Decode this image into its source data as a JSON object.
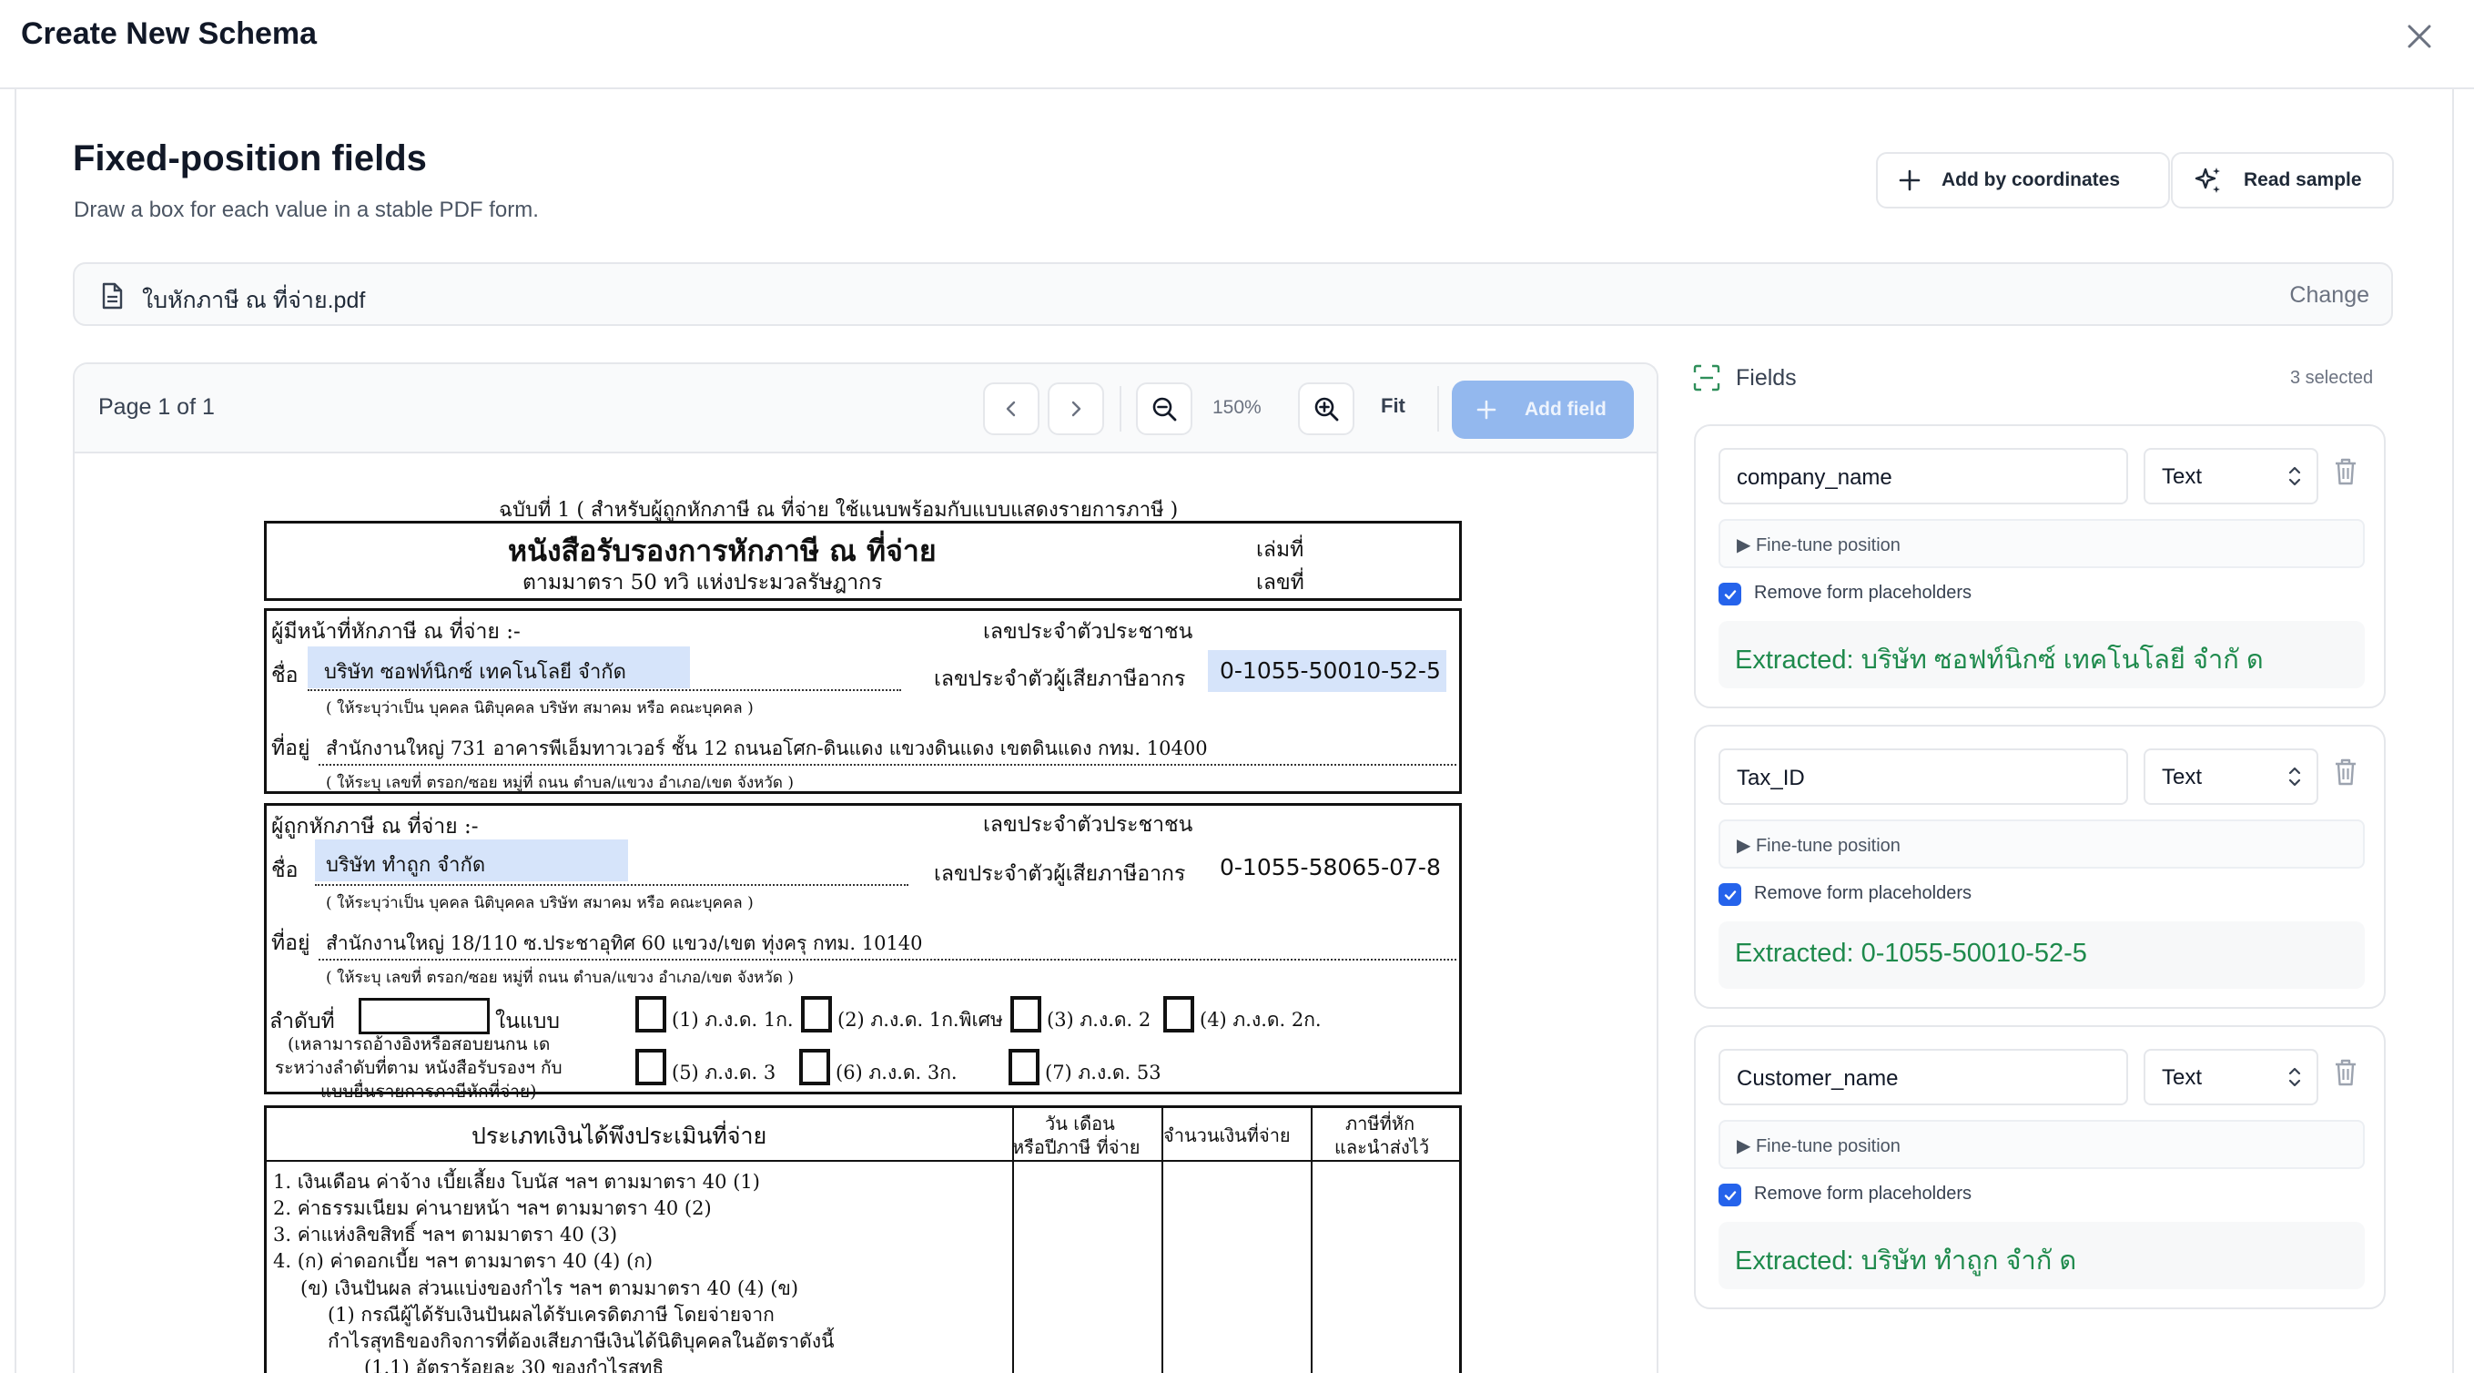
{
  "header": {
    "title": "Create New Schema"
  },
  "section": {
    "title": "Fixed-position fields",
    "subtitle": "Draw a box for each value in a stable PDF form.",
    "add_coords_label": "Add by coordinates",
    "read_sample_label": "Read sample"
  },
  "file": {
    "name": "ใบหักภาษี ณ ที่จ่าย.pdf",
    "change_label": "Change"
  },
  "viewer": {
    "page_label": "Page 1 of 1",
    "zoom": "150%",
    "fit_label": "Fit",
    "add_field_label": "Add field"
  },
  "pdf": {
    "copy_line": "ฉบับที่ 1  ( สำหรับผู้ถูกหักภาษี ณ ที่จ่าย ใช้แนบพร้อมกับแบบแสดงรายการภาษี )",
    "doc_title": "หนังสือรับรองการหักภาษี ณ ที่จ่าย",
    "doc_subtitle": "ตามมาตรา  50  ทวิ  แห่งประมวลรัษฎากร",
    "book_no": "เล่มที่",
    "doc_no": "เลขที่",
    "payer_label": "ผู้มีหน้าที่หักภาษี  ณ  ที่จ่าย :-",
    "id_card_label": "เลขประจำตัวประชาชน",
    "name_label": "ชื่อ",
    "payer_name": "บริษัท ซอฟท์นิกซ์ เทคโนโลยี จำกัด",
    "tax_id_label": "เลขประจำตัวผู้เสียภาษีอากร",
    "payer_tax_id": "0-1055-50010-52-5",
    "name_hint": "( ให้ระบุว่าเป็น บุคคล นิติบุคคล บริษัท สมาคม หรือ คณะบุคคล )",
    "address_label": "ที่อยู่",
    "payer_address": "สำนักงานใหญ่ 731 อาคารพีเอ็มทาวเวอร์ ชั้น 12 ถนนอโศก-ดินแดง แขวงดินแดง เขตดินแดง กทม. 10400",
    "address_hint": "( ให้ระบุ  เลขที่  ตรอก/ซอย  หมู่ที่  ถนน  ตำบล/แขวง  อำเภอ/เขต  จังหวัด )",
    "payee_label": "ผู้ถูกหักภาษี  ณ  ที่จ่าย :-",
    "payee_name": "บริษัท ทำถูก จำกัด",
    "payee_tax_id": "0-1055-58065-07-8",
    "payee_address": "สำนักงานใหญ่ 18/110 ซ.ประชาอุทิศ 60 แขวง/เขต ทุ่งครุ กทม. 10140",
    "seq_label": "ลำดับที่",
    "in_form": "ในแบบ",
    "seq_note1": "(เหลามารถอ้างอิงหรือสอบยนกน เด",
    "seq_note2": "ระหว่างลำดับที่ตาม หนังสือรับรองฯ กับ",
    "seq_note3": "แบบยื่นรายการภาษีหักที่จ่าย)",
    "opt1": "(1) ภ.ง.ด. 1ก.",
    "opt2": "(2) ภ.ง.ด. 1ก.พิเศษ",
    "opt3": "(3) ภ.ง.ด. 2",
    "opt4": "(4) ภ.ง.ด. 2ก.",
    "opt5": "(5) ภ.ง.ด. 3",
    "opt6": "(6) ภ.ง.ด. 3ก.",
    "opt7": "(7) ภ.ง.ด. 53",
    "col1": "ประเภทเงินได้พึงประเมินที่จ่าย",
    "col2a": "วัน  เดือน",
    "col2b": "หรือปีภาษี ที่จ่าย",
    "col3": "จำนวนเงินที่จ่าย",
    "col4a": "ภาษีที่หัก",
    "col4b": "และนำส่งไว้",
    "row1": "1.  เงินเดือน ค่าจ้าง เบี้ยเลี้ยง โบนัส ฯลฯ  ตามมาตรา 40 (1)",
    "row2": "2.  ค่าธรรมเนียม  ค่านายหน้า  ฯลฯ  ตามมาตรา 40 (2)",
    "row3": "3.  ค่าแห่งลิขสิทธิ์  ฯลฯ  ตามมาตรา 40 (3)",
    "row4": "4.  (ก) ค่าดอกเบี้ย ฯลฯ  ตามมาตรา 40 (4) (ก)",
    "row5": "(ข) เงินปันผล ส่วนแบ่งของกำไร ฯลฯ ตามมาตรา 40 (4) (ข)",
    "row6": "(1) กรณีผู้ได้รับเงินปันผลได้รับเครดิตภาษี โดยจ่ายจาก",
    "row7": "กำไรสุทธิของกิจการที่ต้องเสียภาษีเงินได้นิติบุคคลในอัตราดังนี้",
    "row8": "(1.1) อัตราร้อยละ 30 ของกำไรสุทธิ"
  },
  "fields_panel": {
    "title": "Fields",
    "selected": "3 selected",
    "fine_tune_label": "▶ Fine-tune position",
    "remove_label": "Remove form placeholders",
    "items": [
      {
        "name": "company_name",
        "type": "Text",
        "extracted": "Extracted: บริษัท ซอฟท์นิกซ์ เทคโนโลยี จำกั ด"
      },
      {
        "name": "Tax_ID",
        "type": "Text",
        "extracted": "Extracted: 0-1055-50010-52-5"
      },
      {
        "name": "Customer_name",
        "type": "Text",
        "extracted": "Extracted: บริษัท ทำถูก จำกั ด"
      }
    ]
  },
  "colors": {
    "accent": "#2563eb",
    "add_field_bg": "#93b8ee",
    "highlight": "#d6e4fa",
    "extracted_text": "#1e8a4c"
  }
}
